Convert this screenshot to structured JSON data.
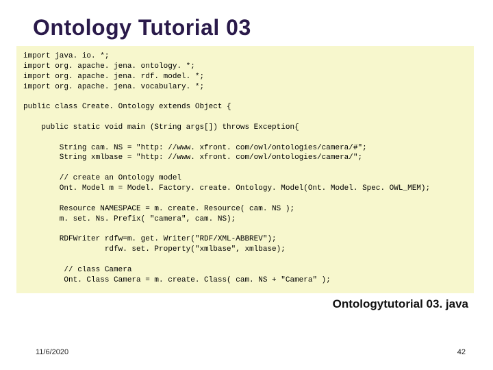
{
  "title": "Ontology Tutorial 03",
  "code": "import java. io. *;\nimport org. apache. jena. ontology. *;\nimport org. apache. jena. rdf. model. *;\nimport org. apache. jena. vocabulary. *;\n\npublic class Create. Ontology extends Object {\n\n    public static void main (String args[]) throws Exception{\n\n        String cam. NS = \"http: //www. xfront. com/owl/ontologies/camera/#\";\n        String xmlbase = \"http: //www. xfront. com/owl/ontologies/camera/\";\n\n        // create an Ontology model\n        Ont. Model m = Model. Factory. create. Ontology. Model(Ont. Model. Spec. OWL_MEM);\n\n        Resource NAMESPACE = m. create. Resource( cam. NS );\n        m. set. Ns. Prefix( \"camera\", cam. NS);\n\n        RDFWriter rdfw=m. get. Writer(\"RDF/XML-ABBREV\");\n                  rdfw. set. Property(\"xmlbase\", xmlbase);\n\n         // class Camera\n         Ont. Class Camera = m. create. Class( cam. NS + \"Camera\" );",
  "filename": "Ontologytutorial 03. java",
  "footer": {
    "date": "11/6/2020",
    "page": "42"
  }
}
